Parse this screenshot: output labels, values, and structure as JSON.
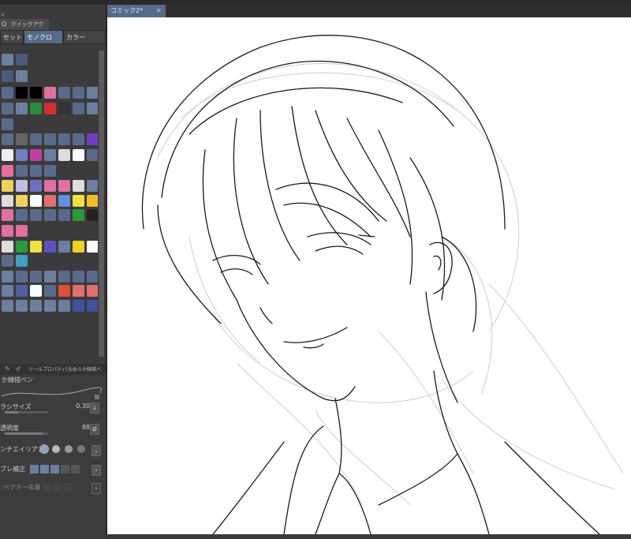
{
  "document": {
    "tab_title": "コミック2*"
  },
  "quick_access": {
    "title": "クイックアクセス",
    "tabs": [
      "セット",
      "モノクロ",
      "カラー"
    ],
    "selected_tab": "モノクロ"
  },
  "tool_property": {
    "title": "ツールプロパティ[なめらか線描ペ",
    "brush_name": "か線描ペン",
    "brush_size_label": "ラシサイズ",
    "brush_size_value": "0.30",
    "opacity_label": "透明度",
    "opacity_value": "88",
    "antialias_label": "ンチエイリアス",
    "stabilization_label": "ブレ補正",
    "vector_label": "ベクター吸着"
  },
  "colors": {
    "accent": "#566a8a",
    "canvas": "#ffffff",
    "panel": "#3b3b3b"
  }
}
